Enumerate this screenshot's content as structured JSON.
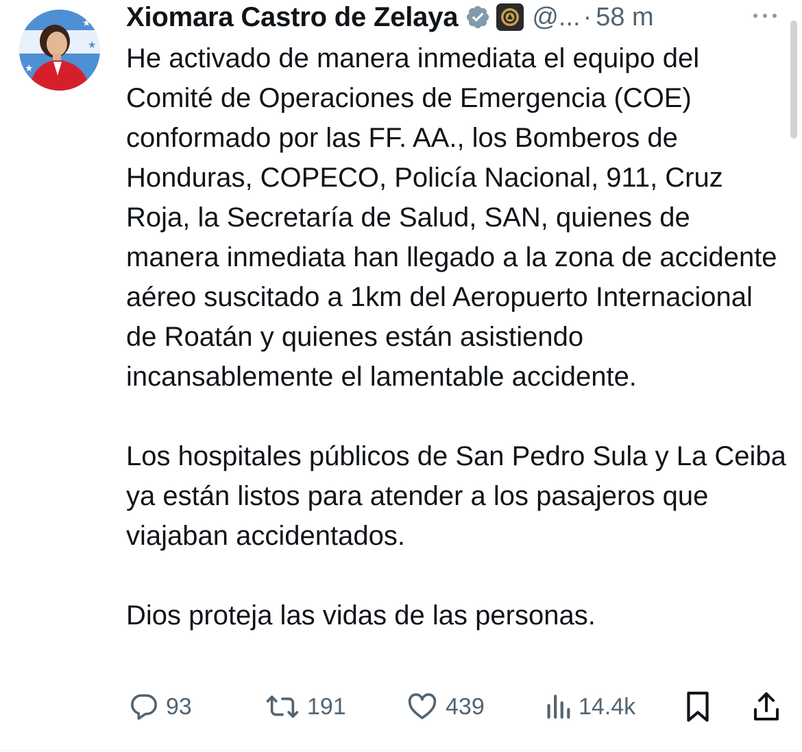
{
  "tweet": {
    "author": {
      "display_name": "Xiomara Castro de Zelaya",
      "handle": "@...",
      "separator": "·",
      "time": "58 m",
      "verified_icon": "verified-badge-icon",
      "affiliate_icon": "government-seal-icon"
    },
    "paragraphs": [
      "He activado de manera inmediata el equipo del Comité de Operaciones de Emergencia (COE) conformado por las FF. AA., los Bomberos de Honduras, COPECO, Policía Nacional, 911, Cruz Roja, la Secretaría de Salud, SAN, quienes de manera inmediata han llegado a la zona de accidente aéreo suscitado a 1km del Aeropuerto Internacional de Roatán y quienes están asistiendo incansablemente el lamentable accidente.",
      "Los hospitales públicos de San Pedro Sula y La Ceiba ya están listos para atender a los pasajeros que viajaban accidentados.",
      "Dios proteja las vidas de las personas."
    ],
    "actions": {
      "replies": "93",
      "reposts": "191",
      "likes": "439",
      "views": "14.4k"
    }
  },
  "colors": {
    "text": "#0f1419",
    "secondary": "#536471",
    "verified_gray": "#829aab"
  }
}
